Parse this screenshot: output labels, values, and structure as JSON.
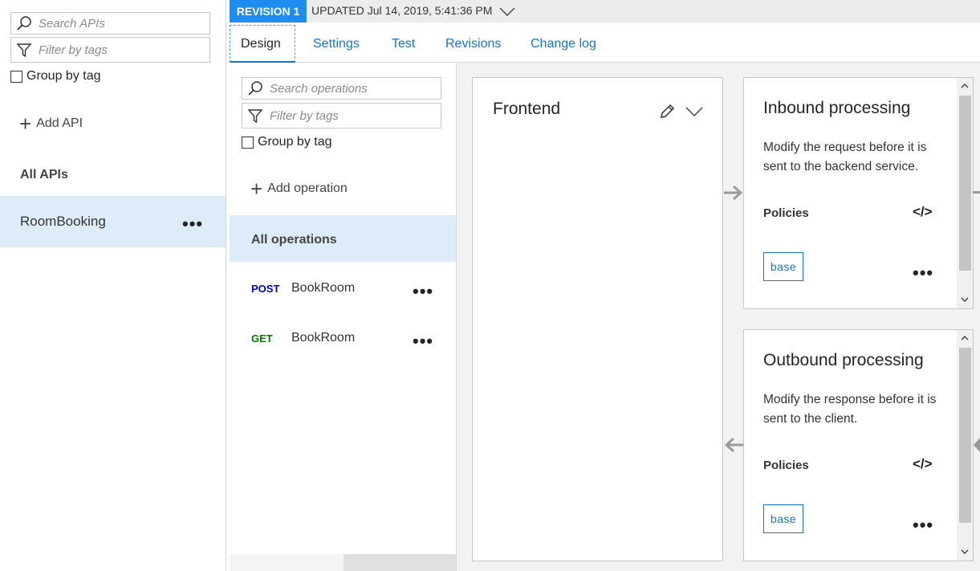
{
  "left_panel": {
    "search_placeholder": "Search APIs",
    "filter_placeholder": "Filter by tags",
    "group_by_tag": "Group by tag",
    "add_api": "Add API",
    "all_apis": "All APIs",
    "apis": [
      {
        "name": "RoomBooking",
        "more": "•••"
      }
    ]
  },
  "revision_bar": {
    "badge": "REVISION 1",
    "updated": "UPDATED Jul 14, 2019, 5:41:36 PM"
  },
  "tabs": [
    {
      "label": "Design",
      "active": true
    },
    {
      "label": "Settings"
    },
    {
      "label": "Test"
    },
    {
      "label": "Revisions"
    },
    {
      "label": "Change log"
    }
  ],
  "operations_panel": {
    "search_placeholder": "Search operations",
    "filter_placeholder": "Filter by tags",
    "group_by_tag": "Group by tag",
    "add_operation": "Add operation",
    "all_operations": "All operations",
    "operations": [
      {
        "method": "POST",
        "method_color": "#0000c8",
        "name": "BookRoom",
        "more": "•••"
      },
      {
        "method": "GET",
        "method_color": "#007a00",
        "name": "BookRoom",
        "more": "•••"
      }
    ]
  },
  "frontend": {
    "title": "Frontend"
  },
  "inbound": {
    "title": "Inbound processing",
    "description": "Modify the request before it is sent to the backend service.",
    "policies_label": "Policies",
    "base_label": "base",
    "more": "•••"
  },
  "outbound": {
    "title": "Outbound processing",
    "description": "Modify the response before it is sent to the client.",
    "policies_label": "Policies",
    "base_label": "base",
    "more": "•••"
  },
  "colors": {
    "accent": "#1e8cf0",
    "link": "#1a74c6",
    "selected_bg": "#deecf9"
  }
}
